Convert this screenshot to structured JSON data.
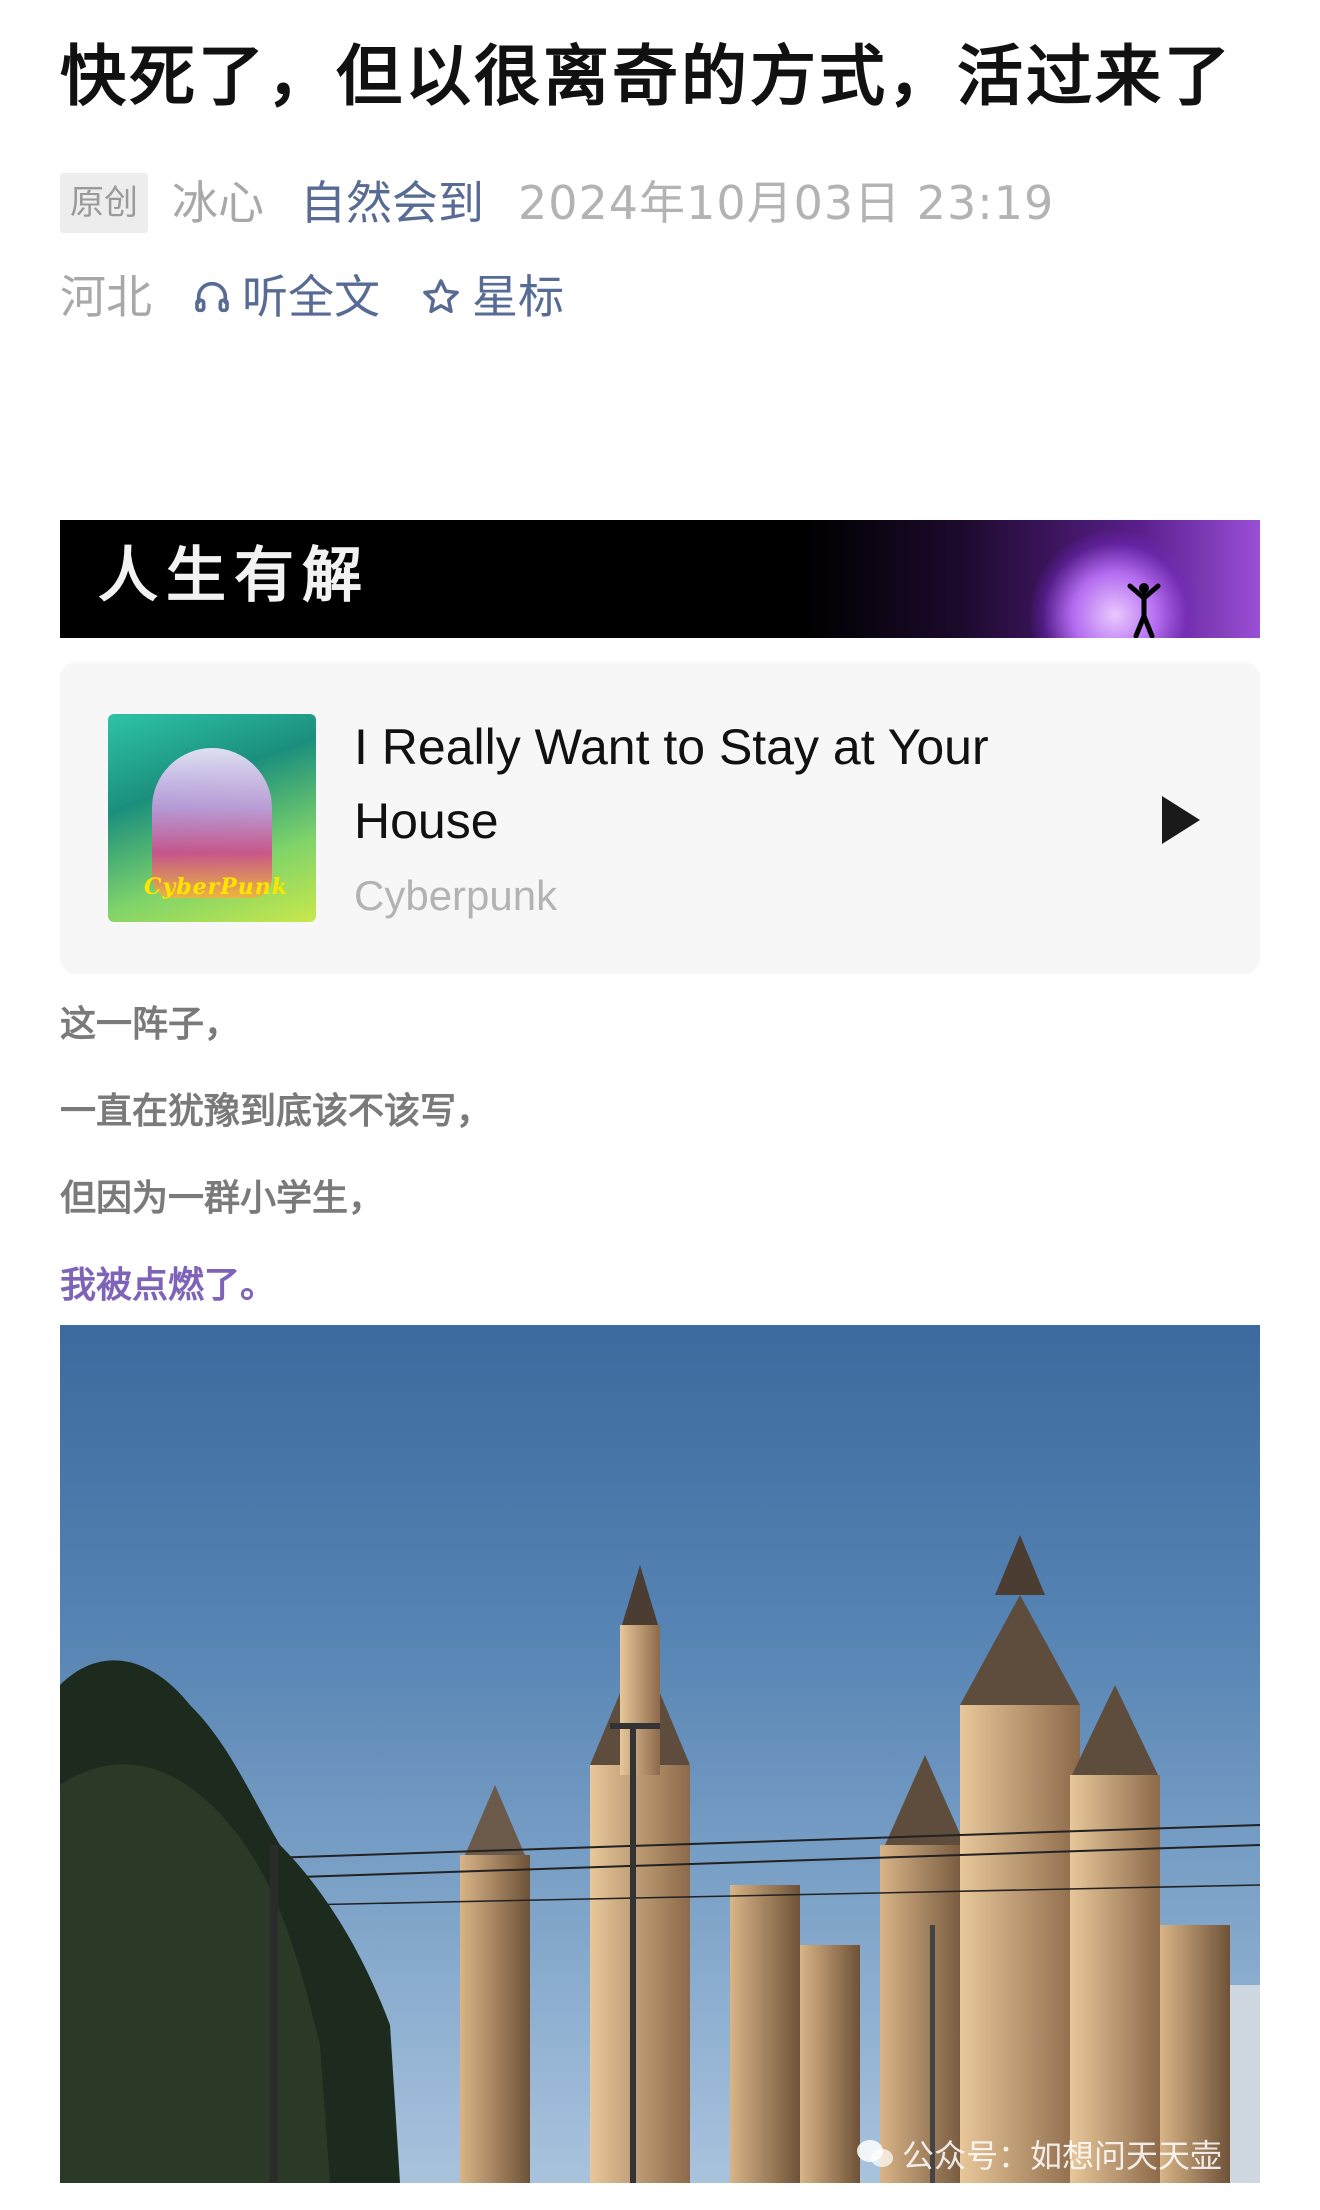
{
  "article": {
    "title": "快死了，但以很离奇的方式，活过来了"
  },
  "meta": {
    "badge": "原创",
    "author": "冰心",
    "account": "自然会到",
    "date": "2024年10月03日 23:19",
    "region": "河北",
    "listen_label": "听全文",
    "star_label": "星标"
  },
  "banner": {
    "title": "人生有解"
  },
  "music": {
    "title": "I Really Want to Stay at Your House",
    "artist": "Cyberpunk",
    "cover_text": "CyberPunk"
  },
  "body": {
    "lines": [
      "这一阵子，",
      "一直在犹豫到底该不该写，",
      "但因为一群小学生，",
      "我被点燃了。"
    ]
  },
  "photo": {
    "watermark": "公众号：如想问天天壶"
  },
  "colors": {
    "link": "#576b95",
    "accent_text": "#7e63b8",
    "muted": "#a8a8a8"
  },
  "icons": {
    "listen": "headphones-icon",
    "star": "star-outline-icon",
    "play": "play-icon",
    "wechat": "wechat-icon"
  }
}
